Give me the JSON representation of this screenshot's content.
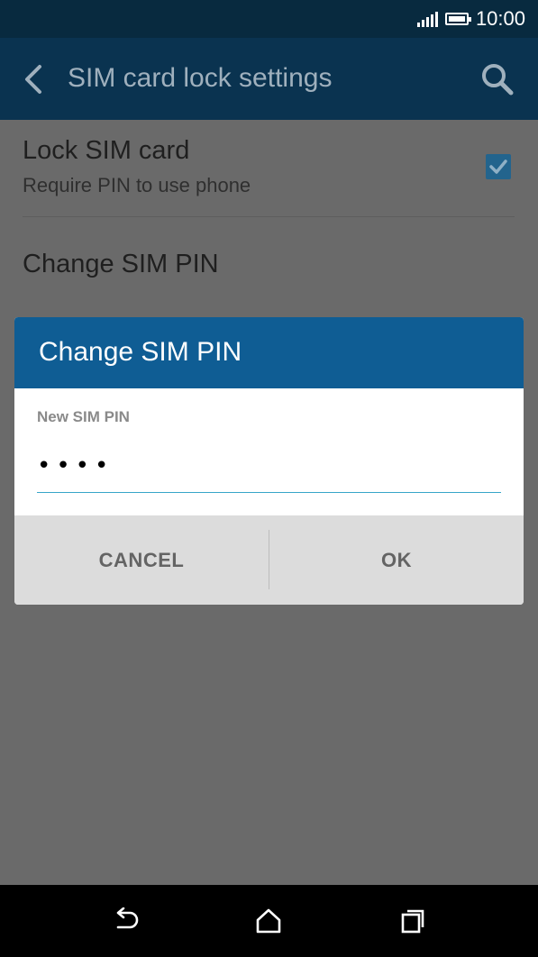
{
  "status_bar": {
    "time": "10:00",
    "icons": [
      "signal-icon",
      "battery-icon"
    ]
  },
  "app_bar": {
    "title": "SIM card lock settings",
    "icons": [
      "back-icon",
      "search-icon"
    ]
  },
  "settings": {
    "lock_sim": {
      "title": "Lock SIM card",
      "subtitle": "Require PIN to use phone",
      "checked": true
    },
    "change_pin": {
      "title": "Change SIM PIN"
    }
  },
  "dialog": {
    "title": "Change SIM PIN",
    "field_label": "New SIM PIN",
    "pin_value": "••••",
    "cancel_label": "CANCEL",
    "ok_label": "OK"
  },
  "nav_bar": {
    "icons": [
      "back-nav-icon",
      "home-icon",
      "recents-icon"
    ]
  },
  "colors": {
    "status_bar": "#082a3f",
    "app_bar_dimmed": "#0a3350",
    "dialog_header": "#0f5d94",
    "input_underline": "#38a5c9",
    "checkbox": "#23648d",
    "scrim_background": "#6a6a6a"
  }
}
